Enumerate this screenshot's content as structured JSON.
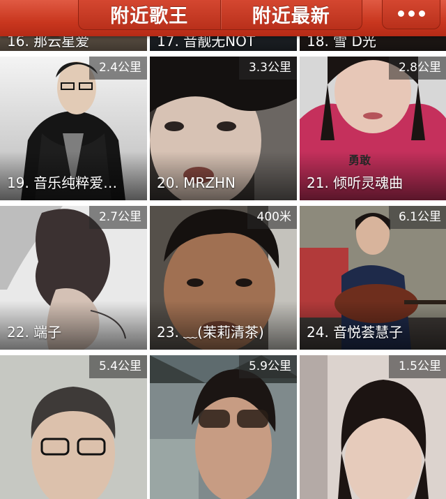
{
  "header": {
    "tabs": [
      "附近歌王",
      "附近最新"
    ],
    "more_icon": "more-dots-icon"
  },
  "tiles": [
    {
      "num": "16. 那云星爱",
      "distance": "",
      "bg": "#c9b49a"
    },
    {
      "num": "17. 音靓无NOT",
      "distance": "",
      "bg": "#5c6670"
    },
    {
      "num": "18. 雪 D光",
      "distance": "",
      "bg": "#70584c"
    },
    {
      "num": "19. 音乐纯粹爱…",
      "distance": "2.4公里",
      "bg": "#cfcfcf"
    },
    {
      "num": "20. MRZHN",
      "distance": "3.3公里",
      "bg": "#55504c"
    },
    {
      "num": "21. 倾听灵魂曲",
      "distance": "2.8公里",
      "bg": "#c93a62"
    },
    {
      "num": "22. 端子",
      "distance": "2.7公里",
      "bg": "#d8d8d8"
    },
    {
      "num": "23. ﹏(茉莉清茶)",
      "distance": "400米",
      "bg": "#5a5048"
    },
    {
      "num": "24. 音悦荟慧子",
      "distance": "6.1公里",
      "bg": "#7a5550"
    },
    {
      "num": "",
      "distance": "5.4公里",
      "bg": "#c7c9c4"
    },
    {
      "num": "",
      "distance": "5.9公里",
      "bg": "#6f7878"
    },
    {
      "num": "",
      "distance": "1.5公里",
      "bg": "#ddd4cf"
    }
  ],
  "overlay_text": "勇敢"
}
